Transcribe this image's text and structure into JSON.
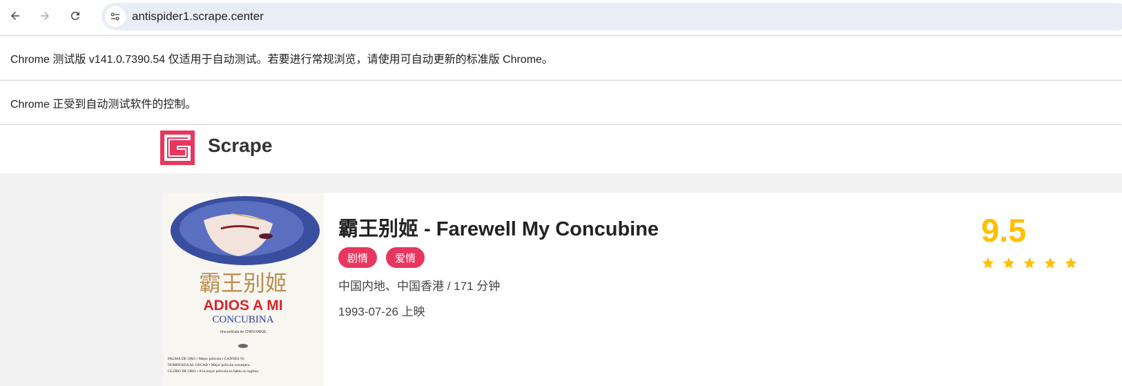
{
  "browser": {
    "url": "antispider1.scrape.center",
    "icons": [
      "back-arrow-icon",
      "forward-arrow-icon",
      "reload-icon",
      "site-settings-icon"
    ]
  },
  "infobars": {
    "beta_notice": "Chrome 测试版 v141.0.7390.54 仅适用于自动测试。若要进行常规浏览，请使用可自动更新的标准版 Chrome。",
    "automation_notice": "Chrome 正受到自动测试软件的控制。"
  },
  "site": {
    "brand": "Scrape",
    "brand_color": "#e8375f"
  },
  "movie": {
    "title": "霸王别姬 - Farewell My Concubine",
    "tags": [
      "剧情",
      "爱情"
    ],
    "region_duration": "中国内地、中国香港 / 171 分钟",
    "release": "1993-07-26 上映",
    "score": "9.5",
    "stars": 5,
    "score_color": "#ffc000",
    "poster": {
      "chinese_title": "霸王别姬",
      "title_line1": "ADIOS A MI",
      "title_line2": "CONCUBINA",
      "director_line": "Una película de CHEN KAIGE",
      "award1": "PALMA DE ORO • Mejor película • CANNES 93",
      "award2": "NOMINADA AL OSCAR • Mejor película extranjera.",
      "award3": "GLOBO DE ORO • A la mejor película en habla no inglesa."
    }
  }
}
